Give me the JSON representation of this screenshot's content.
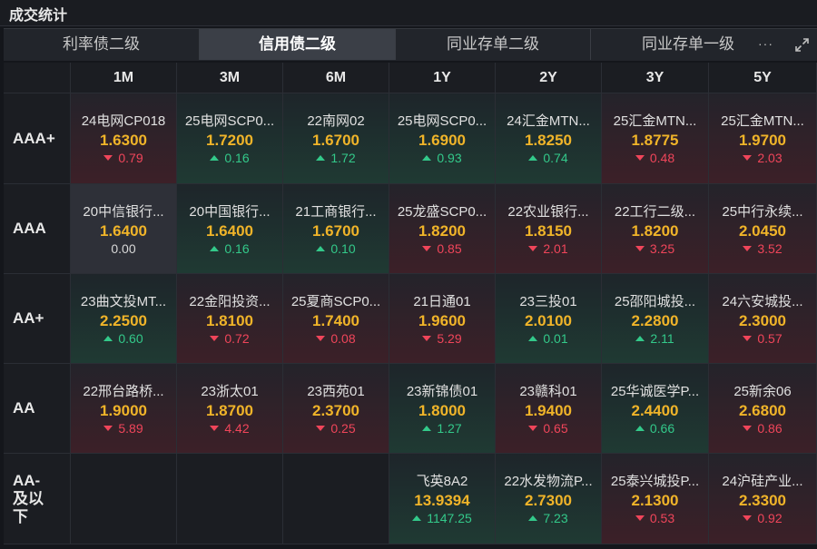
{
  "panel": {
    "title": "成交统计"
  },
  "tabs": [
    {
      "label": "利率债二级",
      "active": false
    },
    {
      "label": "信用债二级",
      "active": true
    },
    {
      "label": "同业存单二级",
      "active": false
    },
    {
      "label": "同业存单一级",
      "active": false
    }
  ],
  "toolbar": {
    "more_icon": "more-dots-icon",
    "more_label": "···",
    "expand_icon": "expand-icon"
  },
  "colors": {
    "price": "#f0b429",
    "up": "#33c98a",
    "down": "#f0455a",
    "active_tab_bg": "#3b3f47"
  },
  "columns": [
    "1M",
    "3M",
    "6M",
    "1Y",
    "2Y",
    "3Y",
    "5Y"
  ],
  "rows": [
    {
      "label": "AAA+",
      "cells": [
        {
          "name": "24电网CP018",
          "price": "1.6300",
          "change": "0.79",
          "dir": "down"
        },
        {
          "name": "25电网SCP0...",
          "price": "1.7200",
          "change": "0.16",
          "dir": "up"
        },
        {
          "name": "22南网02",
          "price": "1.6700",
          "change": "1.72",
          "dir": "up"
        },
        {
          "name": "25电网SCP0...",
          "price": "1.6900",
          "change": "0.93",
          "dir": "up"
        },
        {
          "name": "24汇金MTN...",
          "price": "1.8250",
          "change": "0.74",
          "dir": "up"
        },
        {
          "name": "25汇金MTN...",
          "price": "1.8775",
          "change": "0.48",
          "dir": "down"
        },
        {
          "name": "25汇金MTN...",
          "price": "1.9700",
          "change": "2.03",
          "dir": "down"
        }
      ]
    },
    {
      "label": "AAA",
      "cells": [
        {
          "name": "20中信银行...",
          "price": "1.6400",
          "change": "0.00",
          "dir": "flat"
        },
        {
          "name": "20中国银行...",
          "price": "1.6400",
          "change": "0.16",
          "dir": "up"
        },
        {
          "name": "21工商银行...",
          "price": "1.6700",
          "change": "0.10",
          "dir": "up"
        },
        {
          "name": "25龙盛SCP0...",
          "price": "1.8200",
          "change": "0.85",
          "dir": "down"
        },
        {
          "name": "22农业银行...",
          "price": "1.8150",
          "change": "2.01",
          "dir": "down"
        },
        {
          "name": "22工行二级...",
          "price": "1.8200",
          "change": "3.25",
          "dir": "down"
        },
        {
          "name": "25中行永续...",
          "price": "2.0450",
          "change": "3.52",
          "dir": "down"
        }
      ]
    },
    {
      "label": "AA+",
      "cells": [
        {
          "name": "23曲文投MT...",
          "price": "2.2500",
          "change": "0.60",
          "dir": "up"
        },
        {
          "name": "22金阳投资...",
          "price": "1.8100",
          "change": "0.72",
          "dir": "down"
        },
        {
          "name": "25夏商SCP0...",
          "price": "1.7400",
          "change": "0.08",
          "dir": "down"
        },
        {
          "name": "21日通01",
          "price": "1.9600",
          "change": "5.29",
          "dir": "down"
        },
        {
          "name": "23三投01",
          "price": "2.0100",
          "change": "0.01",
          "dir": "up"
        },
        {
          "name": "25邵阳城投...",
          "price": "2.2800",
          "change": "2.11",
          "dir": "up"
        },
        {
          "name": "24六安城投...",
          "price": "2.3000",
          "change": "0.57",
          "dir": "down"
        }
      ]
    },
    {
      "label": "AA",
      "cells": [
        {
          "name": "22邢台路桥...",
          "price": "1.9000",
          "change": "5.89",
          "dir": "down"
        },
        {
          "name": "23浙太01",
          "price": "1.8700",
          "change": "4.42",
          "dir": "down"
        },
        {
          "name": "23西苑01",
          "price": "2.3700",
          "change": "0.25",
          "dir": "down"
        },
        {
          "name": "23新锦债01",
          "price": "1.8000",
          "change": "1.27",
          "dir": "up"
        },
        {
          "name": "23赣科01",
          "price": "1.9400",
          "change": "0.65",
          "dir": "down"
        },
        {
          "name": "25华诚医学P...",
          "price": "2.4400",
          "change": "0.66",
          "dir": "up"
        },
        {
          "name": "25新余06",
          "price": "2.6800",
          "change": "0.86",
          "dir": "down"
        }
      ]
    },
    {
      "label": "AA-及以下",
      "cells": [
        null,
        null,
        null,
        {
          "name": "飞英8A2",
          "price": "13.9394",
          "change": "1147.25",
          "dir": "up"
        },
        {
          "name": "22水发物流P...",
          "price": "2.7300",
          "change": "7.23",
          "dir": "up"
        },
        {
          "name": "25泰兴城投P...",
          "price": "2.1300",
          "change": "0.53",
          "dir": "down"
        },
        {
          "name": "24沪硅产业...",
          "price": "2.3300",
          "change": "0.92",
          "dir": "down"
        }
      ]
    }
  ]
}
